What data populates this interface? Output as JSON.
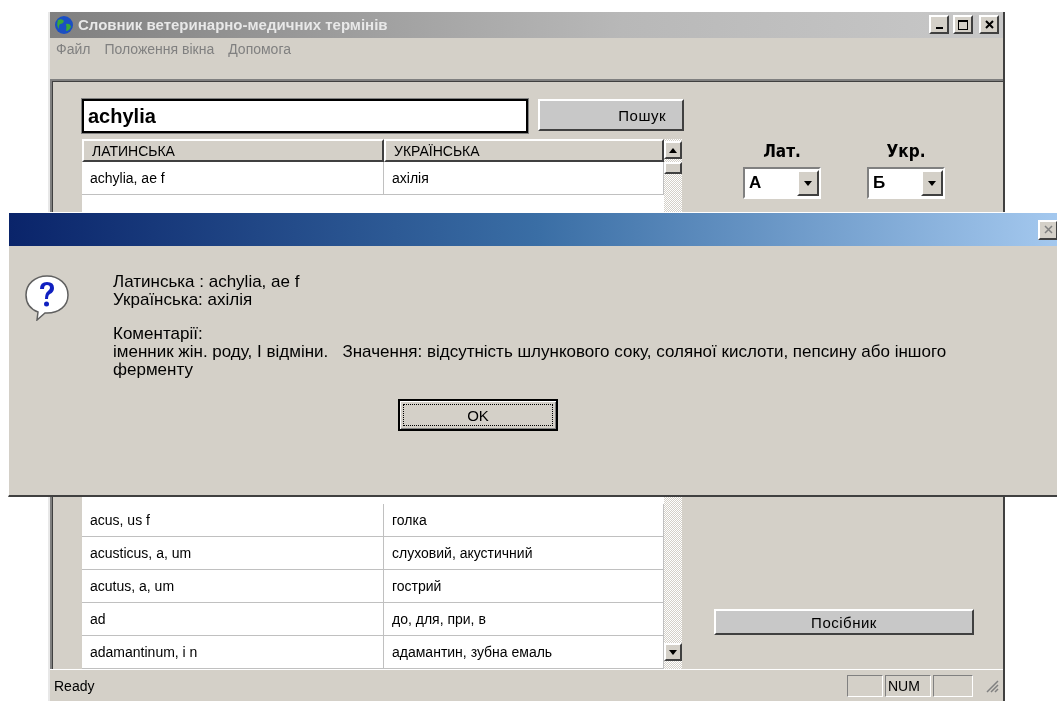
{
  "window": {
    "title": "Словник ветеринарно-медичних термінів"
  },
  "menu": [
    "Файл",
    "Положення вікна",
    "Допомога"
  ],
  "search": {
    "value": "achylia",
    "button": "Пошук"
  },
  "table": {
    "columns": [
      "ЛАТИНСЬКА",
      "УКРАЇНСЬКА"
    ],
    "rows_above_dialog": [
      {
        "latin": "achylia, ae f",
        "ukrainian": "ахілія"
      }
    ],
    "rows_below_dialog": [
      {
        "latin": "acus, us f",
        "ukrainian": "голка"
      },
      {
        "latin": "acusticus, a, um",
        "ukrainian": "слуховий, акустичний"
      },
      {
        "latin": "acutus, a, um",
        "ukrainian": "гострий"
      },
      {
        "latin": "ad",
        "ukrainian": "до, для, при, в"
      },
      {
        "latin": "adamantinum, i n",
        "ukrainian": "адамантин, зубна емаль"
      }
    ]
  },
  "filters": [
    {
      "label": "Лат.",
      "value": "А"
    },
    {
      "label": "Укр.",
      "value": "Б"
    }
  ],
  "guide_button": "Посібник",
  "status_bar": {
    "text": "Ready",
    "indicator": "NUM"
  },
  "dialog": {
    "lines": [
      "Латинська : achylia, ae f",
      "Українська: ахілія"
    ],
    "comment_label": "Коментарії:",
    "comment": "іменник жін. роду, I відміни.   Значення: відсутність шлункового соку, соляної кислоти, пепсину або іншого ферменту",
    "ok_button": "OK"
  }
}
